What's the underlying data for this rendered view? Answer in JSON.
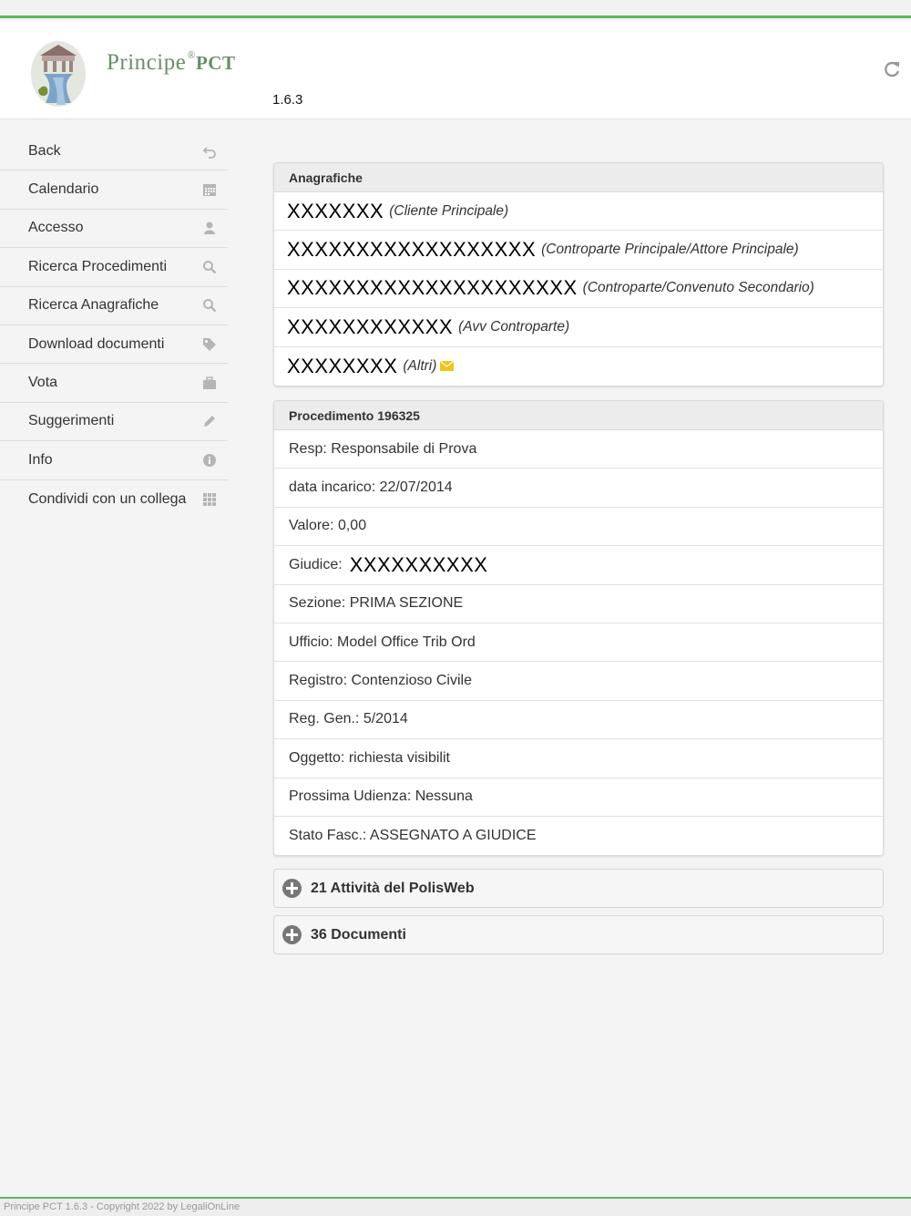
{
  "header": {
    "brand_name": "Principe",
    "brand_reg": "®",
    "brand_suffix": "PCT",
    "version": "1.6.3",
    "refresh_icon": "refresh-icon"
  },
  "sidebar": {
    "items": [
      {
        "label": "Back",
        "icon": "undo-icon"
      },
      {
        "label": "Calendario",
        "icon": "calendar-icon"
      },
      {
        "label": "Accesso",
        "icon": "user-icon"
      },
      {
        "label": "Ricerca Procedimenti",
        "icon": "search-icon"
      },
      {
        "label": "Ricerca Anagrafiche",
        "icon": "search-icon"
      },
      {
        "label": "Download documenti",
        "icon": "tag-icon"
      },
      {
        "label": "Vota",
        "icon": "briefcase-icon"
      },
      {
        "label": "Suggerimenti",
        "icon": "pencil-icon"
      },
      {
        "label": "Info",
        "icon": "info-icon"
      },
      {
        "label": "Condividi con un collega",
        "icon": "grid-icon"
      }
    ]
  },
  "anagrafiche": {
    "title": "Anagrafiche",
    "rows": [
      {
        "name": "XXXXXXX",
        "role": "(Cliente Principale)"
      },
      {
        "name": "XXXXXXXXXXXXXXXXXX",
        "role": "(Controparte Principale/Attore Principale)"
      },
      {
        "name": "XXXXXXXXXXXXXXXXXXXXX",
        "role": "(Controparte/Convenuto Secondario)"
      },
      {
        "name": "XXXXXXXXXXXX",
        "role": "(Avv Controparte)"
      },
      {
        "name": "XXXXXXXX",
        "role": "(Altri)",
        "icon": "envelope-icon"
      }
    ]
  },
  "procedimento": {
    "title": "Procedimento 196325",
    "rows": [
      {
        "text": "Resp: Responsabile di Prova"
      },
      {
        "text": "data incarico: 22/07/2014"
      },
      {
        "text": "Valore: 0,00"
      },
      {
        "text": "Giudice:",
        "value": "XXXXXXXXXX"
      },
      {
        "text": "Sezione: PRIMA SEZIONE"
      },
      {
        "text": "Ufficio: Model Office Trib Ord"
      },
      {
        "text": "Registro: Contenzioso Civile"
      },
      {
        "text": "Reg. Gen.: 5/2014"
      },
      {
        "text": "Oggetto: richiesta visibilit"
      },
      {
        "text": "Prossima Udienza: Nessuna"
      },
      {
        "text": "Stato Fasc.: ASSEGNATO A GIUDICE"
      }
    ]
  },
  "sections": {
    "attivita": "21 Attività del PolisWeb",
    "documenti": "36 Documenti"
  },
  "footer": {
    "text": "Principe PCT 1.6.3 - Copyright 2022 by LegaliOnLine"
  },
  "colors": {
    "accent": "#5cb85c",
    "brand": "#6b8e6b",
    "icon_gray": "#b5b5b5"
  }
}
